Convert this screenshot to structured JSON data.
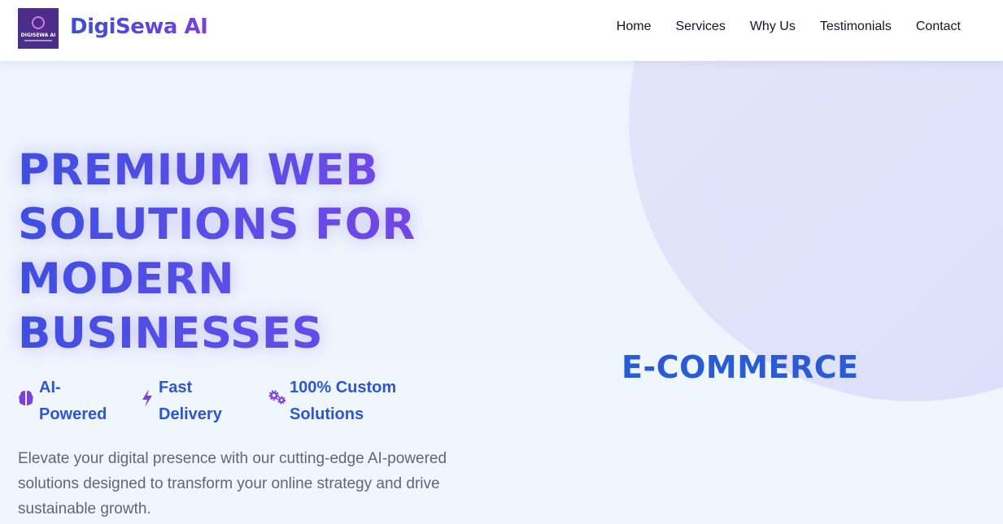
{
  "header": {
    "logo_text": "DIGISEWA AI",
    "brand": "DigiSewa AI",
    "nav": [
      {
        "label": "Home"
      },
      {
        "label": "Services"
      },
      {
        "label": "Why Us"
      },
      {
        "label": "Testimonials"
      },
      {
        "label": "Contact"
      }
    ]
  },
  "hero": {
    "title": "PREMIUM WEB SOLUTIONS FOR MODERN BUSINESSES",
    "features": [
      {
        "icon": "brain-icon",
        "label": "AI-Powered"
      },
      {
        "icon": "bolt-icon",
        "label": "Fast Delivery"
      },
      {
        "icon": "gears-icon",
        "label": "100% Custom Solutions"
      }
    ],
    "description": "Elevate your digital presence with our cutting-edge AI-powered solutions designed to transform your online strategy and drive sustainable growth.",
    "rotating_word": "E-COMMERCE"
  },
  "colors": {
    "brand_gradient_start": "#3a4fd9",
    "brand_gradient_end": "#7a3fe0",
    "feature_text": "#2d55d6",
    "icon_purple": "#7a3fe0",
    "rotating_word": "#2a5bd7"
  }
}
